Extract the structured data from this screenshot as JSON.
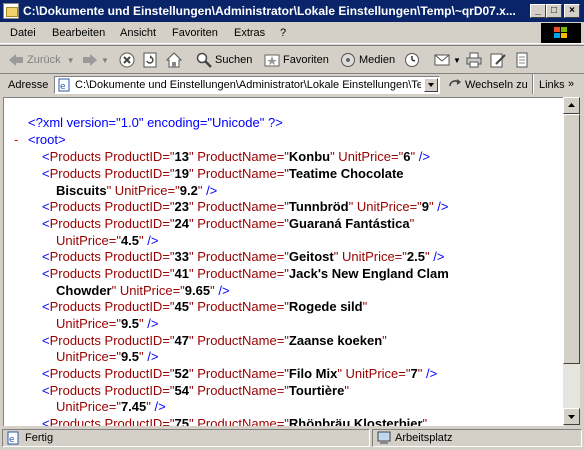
{
  "window": {
    "title": "C:\\Dokumente und Einstellungen\\Administrator\\Lokale Einstellungen\\Temp\\~qrD07.x...",
    "minimize_label": "_",
    "maximize_label": "□",
    "close_label": "×"
  },
  "menu": {
    "items": [
      "Datei",
      "Bearbeiten",
      "Ansicht",
      "Favoriten",
      "Extras",
      "?"
    ]
  },
  "toolbar": {
    "back_label": "Zurück",
    "search_label": "Suchen",
    "favorites_label": "Favoriten",
    "media_label": "Medien"
  },
  "address": {
    "label": "Adresse",
    "value": "C:\\Dokumente und Einstellungen\\Administrator\\Lokale Einstellungen\\Temp\\~qrD07.xml",
    "go_label": "Wechseln zu",
    "links_label": "Links",
    "links_chevron": "»"
  },
  "xml": {
    "declaration": "<?xml version=\"1.0\" encoding=\"Unicode\" ?>",
    "collapse_symbol": "-",
    "root_open": "<root>",
    "lines": [
      {
        "parts": [
          [
            "br",
            "<"
          ],
          [
            "tag",
            "Products"
          ],
          [
            "attr",
            " ProductID=\""
          ],
          [
            "val",
            "13"
          ],
          [
            "attr",
            "\" ProductName=\""
          ],
          [
            "val",
            "Konbu"
          ],
          [
            "attr",
            "\" UnitPrice=\""
          ],
          [
            "val",
            "6"
          ],
          [
            "attr",
            "\""
          ],
          [
            "br",
            " />"
          ]
        ]
      },
      {
        "parts": [
          [
            "br",
            "<"
          ],
          [
            "tag",
            "Products"
          ],
          [
            "attr",
            " ProductID=\""
          ],
          [
            "val",
            "19"
          ],
          [
            "attr",
            "\" ProductName=\""
          ],
          [
            "val",
            "Teatime Chocolate"
          ]
        ]
      },
      {
        "parts": [
          [
            "val",
            "Biscuits"
          ],
          [
            "attr",
            "\" UnitPrice=\""
          ],
          [
            "val",
            "9.2"
          ],
          [
            "attr",
            "\""
          ],
          [
            "br",
            " />"
          ]
        ]
      },
      {
        "parts": [
          [
            "br",
            "<"
          ],
          [
            "tag",
            "Products"
          ],
          [
            "attr",
            " ProductID=\""
          ],
          [
            "val",
            "23"
          ],
          [
            "attr",
            "\" ProductName=\""
          ],
          [
            "val",
            "Tunnbröd"
          ],
          [
            "attr",
            "\" UnitPrice=\""
          ],
          [
            "val",
            "9"
          ],
          [
            "attr",
            "\""
          ],
          [
            "br",
            " />"
          ]
        ]
      },
      {
        "parts": [
          [
            "br",
            "<"
          ],
          [
            "tag",
            "Products"
          ],
          [
            "attr",
            " ProductID=\""
          ],
          [
            "val",
            "24"
          ],
          [
            "attr",
            "\" ProductName=\""
          ],
          [
            "val",
            "Guaraná Fantástica"
          ],
          [
            "attr",
            "\""
          ]
        ]
      },
      {
        "parts": [
          [
            "attr",
            "UnitPrice=\""
          ],
          [
            "val",
            "4.5"
          ],
          [
            "attr",
            "\""
          ],
          [
            "br",
            " />"
          ]
        ]
      },
      {
        "parts": [
          [
            "br",
            "<"
          ],
          [
            "tag",
            "Products"
          ],
          [
            "attr",
            " ProductID=\""
          ],
          [
            "val",
            "33"
          ],
          [
            "attr",
            "\" ProductName=\""
          ],
          [
            "val",
            "Geitost"
          ],
          [
            "attr",
            "\" UnitPrice=\""
          ],
          [
            "val",
            "2.5"
          ],
          [
            "attr",
            "\""
          ],
          [
            "br",
            " />"
          ]
        ]
      },
      {
        "parts": [
          [
            "br",
            "<"
          ],
          [
            "tag",
            "Products"
          ],
          [
            "attr",
            " ProductID=\""
          ],
          [
            "val",
            "41"
          ],
          [
            "attr",
            "\" ProductName=\""
          ],
          [
            "val",
            "Jack's New England Clam"
          ]
        ]
      },
      {
        "parts": [
          [
            "val",
            "Chowder"
          ],
          [
            "attr",
            "\" UnitPrice=\""
          ],
          [
            "val",
            "9.65"
          ],
          [
            "attr",
            "\""
          ],
          [
            "br",
            " />"
          ]
        ]
      },
      {
        "parts": [
          [
            "br",
            "<"
          ],
          [
            "tag",
            "Products"
          ],
          [
            "attr",
            " ProductID=\""
          ],
          [
            "val",
            "45"
          ],
          [
            "attr",
            "\" ProductName=\""
          ],
          [
            "val",
            "Rogede sild"
          ],
          [
            "attr",
            "\""
          ]
        ]
      },
      {
        "parts": [
          [
            "attr",
            "UnitPrice=\""
          ],
          [
            "val",
            "9.5"
          ],
          [
            "attr",
            "\""
          ],
          [
            "br",
            " />"
          ]
        ]
      },
      {
        "parts": [
          [
            "br",
            "<"
          ],
          [
            "tag",
            "Products"
          ],
          [
            "attr",
            " ProductID=\""
          ],
          [
            "val",
            "47"
          ],
          [
            "attr",
            "\" ProductName=\""
          ],
          [
            "val",
            "Zaanse koeken"
          ],
          [
            "attr",
            "\""
          ]
        ]
      },
      {
        "parts": [
          [
            "attr",
            "UnitPrice=\""
          ],
          [
            "val",
            "9.5"
          ],
          [
            "attr",
            "\""
          ],
          [
            "br",
            " />"
          ]
        ]
      },
      {
        "parts": [
          [
            "br",
            "<"
          ],
          [
            "tag",
            "Products"
          ],
          [
            "attr",
            " ProductID=\""
          ],
          [
            "val",
            "52"
          ],
          [
            "attr",
            "\" ProductName=\""
          ],
          [
            "val",
            "Filo Mix"
          ],
          [
            "attr",
            "\" UnitPrice=\""
          ],
          [
            "val",
            "7"
          ],
          [
            "attr",
            "\""
          ],
          [
            "br",
            " />"
          ]
        ]
      },
      {
        "parts": [
          [
            "br",
            "<"
          ],
          [
            "tag",
            "Products"
          ],
          [
            "attr",
            " ProductID=\""
          ],
          [
            "val",
            "54"
          ],
          [
            "attr",
            "\" ProductName=\""
          ],
          [
            "val",
            "Tourtière"
          ],
          [
            "attr",
            "\""
          ]
        ]
      },
      {
        "parts": [
          [
            "attr",
            "UnitPrice=\""
          ],
          [
            "val",
            "7.45"
          ],
          [
            "attr",
            "\""
          ],
          [
            "br",
            " />"
          ]
        ]
      },
      {
        "parts": [
          [
            "br",
            "<"
          ],
          [
            "tag",
            "Products"
          ],
          [
            "attr",
            " ProductID=\""
          ],
          [
            "val",
            "75"
          ],
          [
            "attr",
            "\" ProductName=\""
          ],
          [
            "val",
            "Rhönbräu Klosterbier"
          ],
          [
            "attr",
            "\""
          ]
        ]
      }
    ]
  },
  "status": {
    "text": "Fertig",
    "zone": "Arbeitsplatz"
  },
  "colors": {
    "titlebar": "#0a246a",
    "xml_tag": "#990000",
    "xml_markup": "#0000ff",
    "collapse": "#ff0000"
  }
}
